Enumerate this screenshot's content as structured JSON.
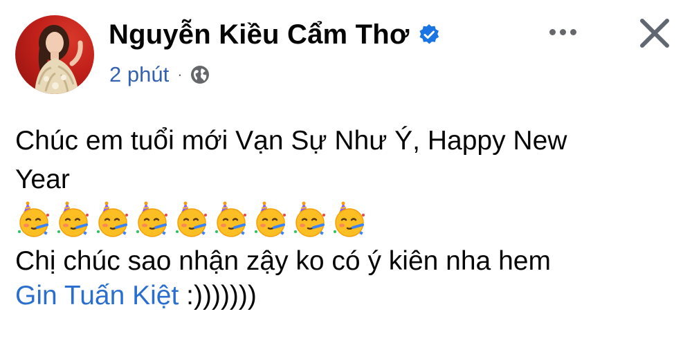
{
  "post": {
    "author": "Nguyễn Kiều Cẩm Thơ",
    "verified": true,
    "time": "2 phút",
    "separator": "·",
    "audience_icon": "globe-icon",
    "more_icon": "more-options-icon",
    "close_icon": "close-icon",
    "body": {
      "line1": "Chúc em tuổi mới Vạn Sự Như Ý, Happy New",
      "line2": "Year",
      "emoji_name": "partying-face-emoji",
      "emoji_count": 9,
      "line3": "Chị chúc sao nhận zậy ko có ý kiên nha hem",
      "mention": "Gin Tuấn Kiệt",
      "mention_suffix": " :)))))))"
    }
  },
  "colors": {
    "link": "#2a6fcf",
    "verified_badge": "#1b74e4",
    "text": "#050505",
    "secondary": "#65676b"
  }
}
